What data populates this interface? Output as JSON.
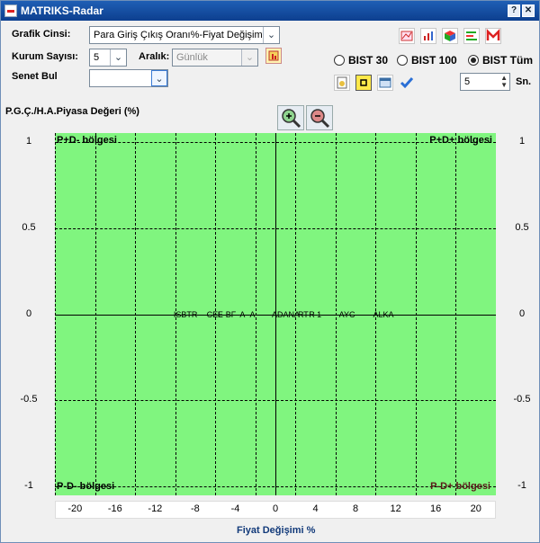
{
  "window": {
    "title": "MATRIKS-Radar"
  },
  "form": {
    "chart_type_label": "Grafik Cinsi:",
    "chart_type_value": "Para Giriş Çıkış Oranı%-Fiyat Değişimi",
    "count_label": "Kurum Sayısı:",
    "count_value": "5",
    "interval_label": "Aralık:",
    "interval_value": "Günlük",
    "find_label": "Senet Bul",
    "find_value": ""
  },
  "index_options": [
    "BIST 30",
    "BIST 100",
    "BIST Tüm"
  ],
  "selected_index": "BIST Tüm",
  "spin": {
    "value": "5",
    "unit": "Sn."
  },
  "icons": {
    "toolbar": [
      "chart-icon",
      "bar-chart-icon",
      "cube-icon",
      "list-icon",
      "m-logo-icon"
    ],
    "toolbar2": [
      "settings-icon",
      "yellow-square-icon",
      "window-icon",
      "check-icon"
    ]
  },
  "chart_data": {
    "type": "scatter",
    "ylabel": "P.G.Ç./H.A.Piyasa Değeri (%)",
    "xlabel": "Fiyat Değişimi %",
    "xlim": [
      -22,
      22
    ],
    "ylim": [
      -1.05,
      1.05
    ],
    "x_ticks": [
      "-20",
      "-16",
      "-12",
      "-8",
      "-4",
      "0",
      "4",
      "8",
      "12",
      "16",
      "20"
    ],
    "y_ticks": [
      "1",
      "0.5",
      "0",
      "-0.5",
      "-1"
    ],
    "quadrants": {
      "top_left": "P+D- bölgesi",
      "top_right": "P+D+ bölgesi",
      "bottom_left": "P-D- bölgesi",
      "bottom_right": "P-D+ bölgesi"
    },
    "points": [
      {
        "label": "ISBTR",
        "x": -9.8,
        "y": 0.0
      },
      {
        "label": "CEL",
        "x": -6.5,
        "y": 0.0
      },
      {
        "label": "E",
        "x": -5.4,
        "y": 0.0
      },
      {
        "label": "BF",
        "x": -4.6,
        "y": 0.0
      },
      {
        "label": "A",
        "x": -3.2,
        "y": 0.0
      },
      {
        "label": "A",
        "x": -2.2,
        "y": 0.0
      },
      {
        "label": "ADANA",
        "x": 0.0,
        "y": 0.0
      },
      {
        "label": "RT",
        "x": 2.6,
        "y": 0.0
      },
      {
        "label": "R",
        "x": 3.7,
        "y": 0.0
      },
      {
        "label": "1",
        "x": 4.5,
        "y": 0.0
      },
      {
        "label": "AYC",
        "x": 6.7,
        "y": 0.0
      },
      {
        "label": "ALKA",
        "x": 10.1,
        "y": 0.0
      }
    ],
    "grid": true,
    "background": "#80f57f"
  }
}
